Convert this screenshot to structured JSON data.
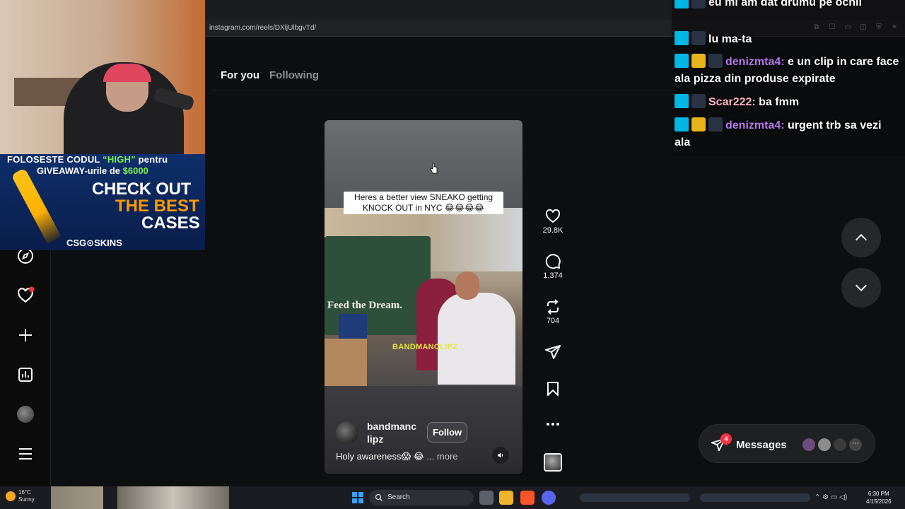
{
  "browser": {
    "url": "instagram.com/reels/DXljUlbgvTd/"
  },
  "instagram": {
    "tabs": [
      {
        "label": "For you",
        "active": true
      },
      {
        "label": "Following",
        "active": false
      }
    ],
    "sidebar_icons": [
      "explore-icon",
      "heart-icon",
      "create-icon",
      "insights-icon",
      "profile-avatar",
      "menu-icon"
    ],
    "reel": {
      "caption_overlay": "Heres a better view SNEAKO getting KNOCK OUT in NYC 😂😂😂😂",
      "watermark": "BANDMANCLIPZ",
      "author": "bandmanc lipz",
      "follow_label": "Follow",
      "caption": "Holy awareness😱 😂",
      "more_label": "... more"
    },
    "actions": {
      "likes": "29.8K",
      "comments": "1,374",
      "reposts": "704"
    },
    "messages": {
      "label": "Messages",
      "badge": "4"
    }
  },
  "stream_overlay": {
    "promo": {
      "line1_prefix": "FOLOSESTE CODUL ",
      "code": "“HIGH”",
      "line1_suffix": " pentru",
      "line2_prefix": "GIVEAWAY-urile de ",
      "amount": "$6000",
      "cta1": "CHECK OUT",
      "cta2": "THE BEST",
      "cta3": "CASES",
      "brand": "CSG⊙SKINS"
    },
    "chat": [
      {
        "user": "",
        "message": "eu mi am dat drumu pe ochii"
      },
      {
        "user": "",
        "message": "lu ma-ta"
      },
      {
        "user": "denizmta4:",
        "message": "e un clip in care face ala pizza din produse expirate"
      },
      {
        "user": "Scar222:",
        "message": "ba fmm"
      },
      {
        "user": "denizmta4:",
        "message": "urgent trb sa vezi ala"
      }
    ]
  },
  "taskbar": {
    "temperature": "16°C",
    "weather": "Sunny",
    "search_label": "Search",
    "time": "6:30 PM",
    "date": "4/15/2026"
  },
  "colors": {
    "page_bg": "#0d0e10",
    "like_accent": "#ff3040",
    "chat_purple": "#b678ea",
    "promo_green": "#7bf24a",
    "promo_orange": "#ff9a00"
  }
}
